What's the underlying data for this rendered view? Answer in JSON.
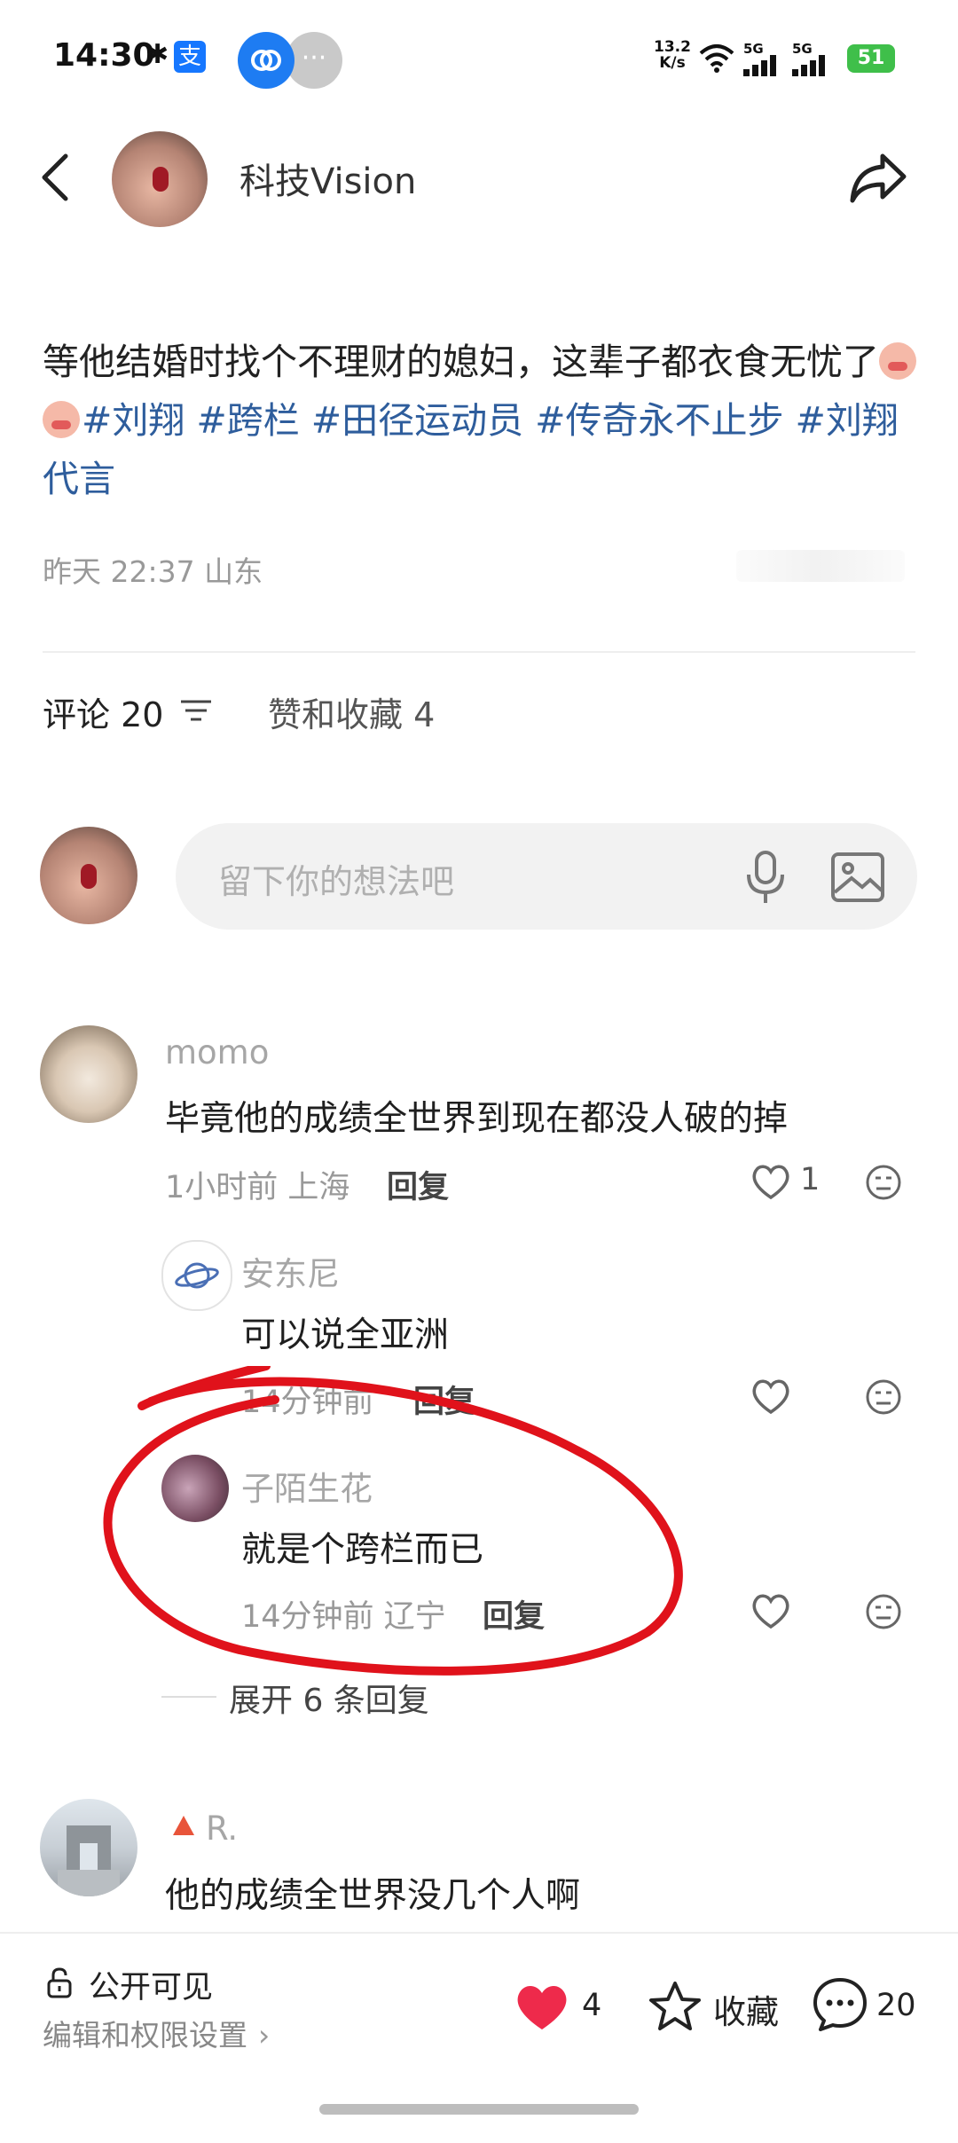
{
  "status_bar": {
    "time": "14:30",
    "alipay_icon": "支",
    "speed_value": "13.2",
    "speed_unit": "K/s",
    "net1": "5G",
    "net2": "5G",
    "battery": "51",
    "more": "···"
  },
  "header": {
    "author": "科技Vision"
  },
  "post": {
    "text_before": "等他结婚时找个不理财的媳妇，这辈子都衣食无忧了",
    "tags": "#刘翔 #跨栏 #田径运动员 #传奇永不止步 #刘翔代言",
    "time_location": "昨天 22:37 山东"
  },
  "tabs": {
    "comments": "评论 20",
    "likes_favorites": "赞和收藏 4"
  },
  "input": {
    "placeholder": "留下你的想法吧"
  },
  "comments": [
    {
      "name": "momo",
      "text": "毕竟他的成绩全世界到现在都没人破的掉",
      "meta": "1小时前 上海",
      "reply": "回复",
      "likes": "1"
    },
    {
      "name": "安东尼",
      "text": "可以说全亚洲",
      "meta": "14分钟前",
      "reply": "回复"
    },
    {
      "name": "子陌生花",
      "text": "就是个跨栏而已",
      "meta": "14分钟前 辽宁",
      "reply": "回复"
    },
    {
      "name": "R.",
      "text": "他的成绩全世界没几个人啊"
    }
  ],
  "expand": "展开 6 条回复",
  "bottom_bar": {
    "visibility": "公开可见",
    "permission": "编辑和权限设置",
    "likes": "4",
    "collect": "收藏",
    "comments": "20"
  },
  "colors": {
    "tag": "#2e5d9c",
    "like_red": "#ee2a4b",
    "annotation_red": "#e0121b",
    "battery_green": "#3fbf4a"
  }
}
